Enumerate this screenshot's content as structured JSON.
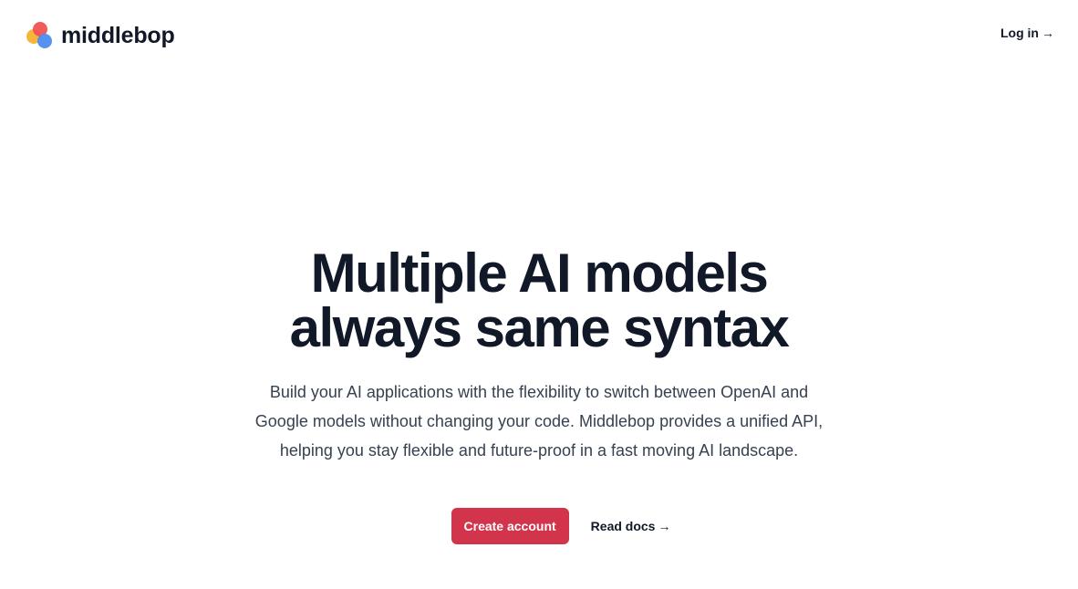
{
  "header": {
    "brand_name": "middlebop",
    "login_label": "Log in",
    "login_arrow": "→"
  },
  "hero": {
    "headline_lines": [
      "Multiple AI models",
      "always same syntax"
    ],
    "subtext_lines": [
      "Build your AI applications with the flexibility to switch between OpenAI and",
      "Google models without changing your code. Middlebop provides a unified API,",
      "helping you stay flexible and future-proof in a fast moving AI landscape."
    ],
    "primary_cta": "Create account",
    "secondary_cta": "Read docs",
    "secondary_arrow": "→"
  },
  "colors": {
    "primary": "#d1344b",
    "text": "#111827",
    "logo_yellow": "#f6b63b",
    "logo_red": "#ef5350",
    "logo_blue": "#4d8df0"
  },
  "icons": {
    "logo": "middlebop-logo-icon",
    "arrow": "arrow-right-icon"
  }
}
